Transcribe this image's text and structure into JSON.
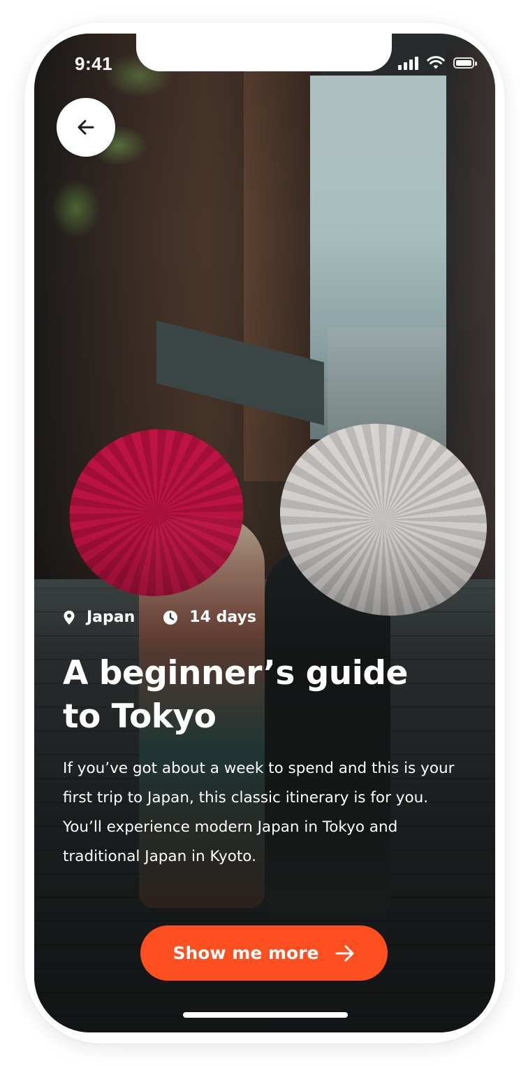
{
  "status_bar": {
    "time": "9:41",
    "icons": [
      "cellular-signal-icon",
      "wifi-icon",
      "battery-icon"
    ]
  },
  "navigation": {
    "back_icon": "arrow-left-icon"
  },
  "hero_image": {
    "icon": "photo"
  },
  "trip": {
    "location_icon": "map-pin-icon",
    "location": "Japan",
    "duration_icon": "clock-icon",
    "duration": "14 days",
    "title": "A beginner’s guide to Tokyo",
    "description": "If you’ve got about a week to spend and this is your first trip to Japan, this classic itinerary is for you. You’ll experience modern Japan in Tokyo and traditional Japan in Kyoto."
  },
  "cta": {
    "label": "Show me more",
    "icon": "arrow-right-icon"
  },
  "colors": {
    "accent": "#fd4f1f",
    "text_on_image": "#ffffff",
    "frame": "#ffffff"
  }
}
